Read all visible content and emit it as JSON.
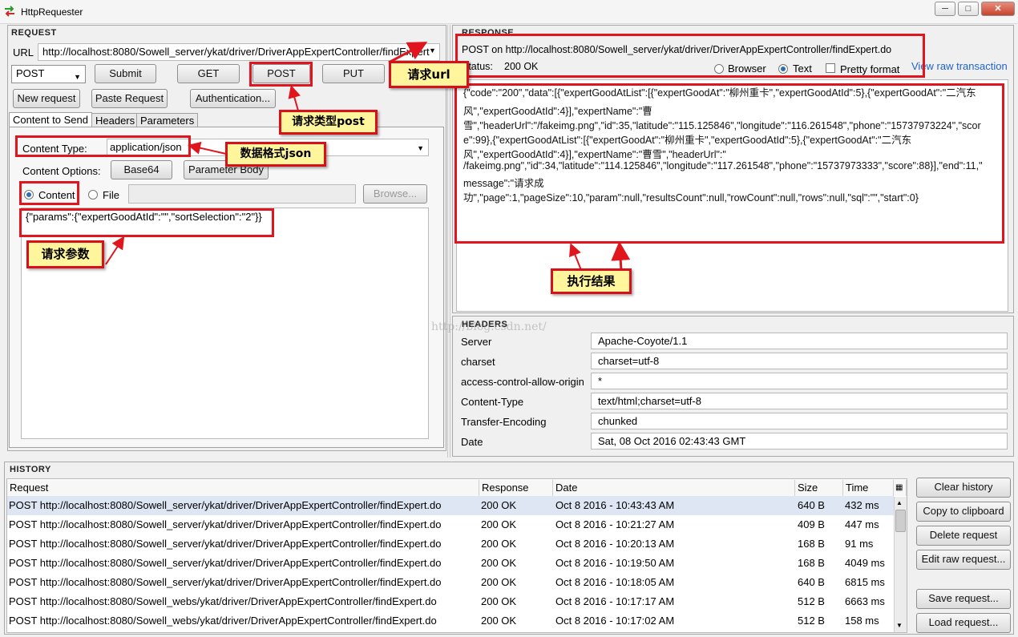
{
  "window": {
    "title": "HttpRequester",
    "min_label": "─",
    "max_label": "□",
    "close_label": "✕"
  },
  "request": {
    "section_title": "Request",
    "url_label": "URL",
    "url_value": "http://localhost:8080/Sowell_server/ykat/driver/DriverAppExpertController/findExpert",
    "method_value": "POST",
    "buttons": {
      "submit": "Submit",
      "get": "GET",
      "post": "POST",
      "put": "PUT",
      "new_request": "New request",
      "paste_request": "Paste Request",
      "authentication": "Authentication..."
    },
    "tabs": [
      "Content to Send",
      "Headers",
      "Parameters"
    ],
    "content_type_label": "Content Type:",
    "content_type_value": "application/json",
    "content_options_label": "Content Options:",
    "base64_label": "Base64",
    "parameter_body_label": "Parameter Body",
    "radio_content": "Content",
    "radio_file": "File",
    "browse_label": "Browse...",
    "body_text": "{\"params\":{\"expertGoodAtId\":\"\",\"sortSelection\":\"2\"}}"
  },
  "response": {
    "section_title": "Response",
    "post_on": "POST on http://localhost:8080/Sowell_server/ykat/driver/DriverAppExpertController/findExpert.do",
    "status_label": "Status:",
    "status_value": "200 OK",
    "view_browser": "Browser",
    "view_text": "Text",
    "pretty_format": "Pretty format",
    "view_raw": "View raw transaction",
    "body_lines": [
      "{\"code\":\"200\",\"data\":[{\"expertGoodAtList\":[{\"expertGoodAt\":\"柳州重卡\",\"expertGoodAtId\":5},{\"expertGoodAt\":\"二汽东",
      "风\",\"expertGoodAtId\":4}],\"expertName\":\"曹",
      "雪\",\"headerUrl\":\"/fakeimg.png\",\"id\":35,\"latitude\":\"115.125846\",\"longitude\":\"116.261548\",\"phone\":\"15737973224\",\"scor",
      "e\":99},{\"expertGoodAtList\":[{\"expertGoodAt\":\"柳州重卡\",\"expertGoodAtId\":5},{\"expertGoodAt\":\"二汽东",
      "风\",\"expertGoodAtId\":4}],\"expertName\":\"曹雪\",\"headerUrl\":\"",
      "/fakeimg.png\",\"id\":34,\"latitude\":\"114.125846\",\"longitude\":\"117.261548\",\"phone\":\"15737973333\",\"score\":88}],\"end\":11,\"",
      "message\":\"请求成",
      "功\",\"page\":1,\"pageSize\":10,\"param\":null,\"resultsCount\":null,\"rowCount\":null,\"rows\":null,\"sql\":\"\",\"start\":0}"
    ]
  },
  "headers": {
    "section_title": "Headers",
    "rows": [
      {
        "key": "Server",
        "value": "Apache-Coyote/1.1"
      },
      {
        "key": "charset",
        "value": "charset=utf-8"
      },
      {
        "key": "access-control-allow-origin",
        "value": "*"
      },
      {
        "key": "Content-Type",
        "value": "text/html;charset=utf-8"
      },
      {
        "key": "Transfer-Encoding",
        "value": "chunked"
      },
      {
        "key": "Date",
        "value": "Sat, 08 Oct 2016 02:43:43 GMT"
      }
    ]
  },
  "history": {
    "section_title": "History",
    "columns": [
      "Request",
      "Response",
      "Date",
      "Size",
      "Time"
    ],
    "rows": [
      {
        "request": "POST http://localhost:8080/Sowell_server/ykat/driver/DriverAppExpertController/findExpert.do",
        "response": "200 OK",
        "date": "Oct 8 2016 - 10:43:43 AM",
        "size": "640 B",
        "time": "432 ms"
      },
      {
        "request": "POST http://localhost:8080/Sowell_server/ykat/driver/DriverAppExpertController/findExpert.do",
        "response": "200 OK",
        "date": "Oct 8 2016 - 10:21:27 AM",
        "size": "409 B",
        "time": "447 ms"
      },
      {
        "request": "POST http://localhost:8080/Sowell_server/ykat/driver/DriverAppExpertController/findExpert.do",
        "response": "200 OK",
        "date": "Oct 8 2016 - 10:20:13 AM",
        "size": "168 B",
        "time": "91 ms"
      },
      {
        "request": "POST http://localhost:8080/Sowell_server/ykat/driver/DriverAppExpertController/findExpert.do",
        "response": "200 OK",
        "date": "Oct 8 2016 - 10:19:50 AM",
        "size": "168 B",
        "time": "4049 ms"
      },
      {
        "request": "POST http://localhost:8080/Sowell_server/ykat/driver/DriverAppExpertController/findExpert.do",
        "response": "200 OK",
        "date": "Oct 8 2016 - 10:18:05 AM",
        "size": "640 B",
        "time": "6815 ms"
      },
      {
        "request": "POST http://localhost:8080/Sowell_webs/ykat/driver/DriverAppExpertController/findExpert.do",
        "response": "200 OK",
        "date": "Oct 8 2016 - 10:17:17 AM",
        "size": "512 B",
        "time": "6663 ms"
      },
      {
        "request": "POST http://localhost:8080/Sowell_webs/ykat/driver/DriverAppExpertController/findExpert.do",
        "response": "200 OK",
        "date": "Oct 8 2016 - 10:17:02 AM",
        "size": "512 B",
        "time": "158 ms"
      }
    ],
    "buttons": {
      "clear": "Clear history",
      "copy": "Copy to clipboard",
      "delete": "Delete request",
      "edit": "Edit raw request...",
      "save": "Save request...",
      "load": "Load request..."
    }
  },
  "annotations": {
    "url_note": "请求url",
    "post_note": "请求类型post",
    "json_note": "数据格式json",
    "params_note": "请求参数",
    "result_note": "执行结果"
  },
  "watermark": "http://blog.csdn.net/",
  "colors": {
    "annotation_red": "#e0151d",
    "note_fill": "#fff59c",
    "link_blue": "#1f63c9"
  }
}
